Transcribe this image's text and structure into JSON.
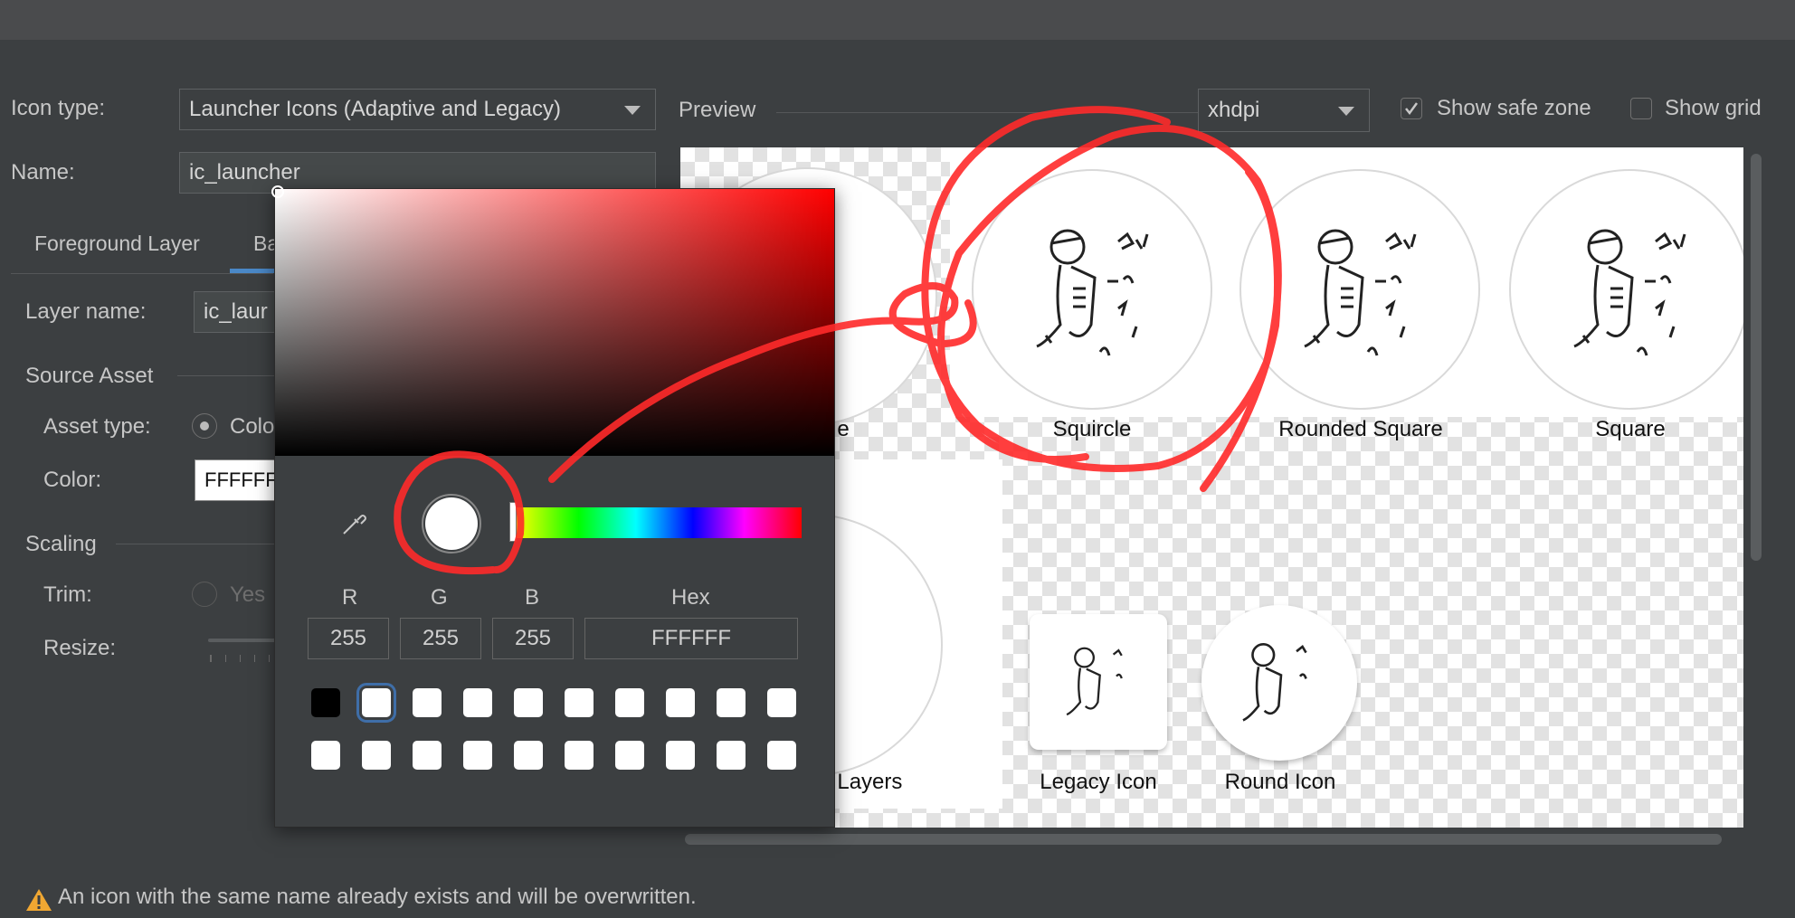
{
  "form": {
    "icon_type_label": "Icon type:",
    "icon_type_value": "Launcher Icons (Adaptive and Legacy)",
    "name_label": "Name:",
    "name_value": "ic_launcher",
    "tabs": [
      {
        "label": "Foreground Layer"
      },
      {
        "label": "Ba"
      }
    ],
    "layer_name_label": "Layer name:",
    "layer_name_value": "ic_laur",
    "source_asset_label": "Source Asset",
    "asset_type_label": "Asset type:",
    "asset_type_option": "Colo",
    "color_label": "Color:",
    "color_value": "FFFFFF",
    "scaling_label": "Scaling",
    "trim_label": "Trim:",
    "trim_option": "Yes",
    "resize_label": "Resize:"
  },
  "preview": {
    "label": "Preview",
    "density": "xhdpi",
    "show_safe_zone": {
      "label": "Show safe zone",
      "checked": true
    },
    "show_grid": {
      "label": "Show grid",
      "checked": false
    },
    "icons": [
      {
        "caption": "e"
      },
      {
        "caption": "Squircle"
      },
      {
        "caption": "Rounded Square"
      },
      {
        "caption": "Square"
      },
      {
        "caption": "ed Layers"
      },
      {
        "caption": "Legacy Icon"
      },
      {
        "caption": "Round Icon"
      }
    ]
  },
  "color_picker": {
    "r_label": "R",
    "g_label": "G",
    "b_label": "B",
    "hex_label": "Hex",
    "r": "255",
    "g": "255",
    "b": "255",
    "hex": "FFFFFF",
    "selected_color": "#ffffff",
    "recent_colors": [
      "#000000",
      "#ffffff",
      "#ffffff",
      "#ffffff",
      "#ffffff",
      "#ffffff",
      "#ffffff",
      "#ffffff",
      "#ffffff",
      "#ffffff"
    ],
    "more_colors": [
      "#ffffff",
      "#ffffff",
      "#ffffff",
      "#ffffff",
      "#ffffff",
      "#ffffff",
      "#ffffff",
      "#ffffff",
      "#ffffff",
      "#ffffff"
    ]
  },
  "status": {
    "warning": "An icon with the same name already exists and will be overwritten."
  },
  "colors": {
    "accent": "#4a88c7",
    "annotation": "#ff2a2a",
    "warning": "#f0a732"
  }
}
